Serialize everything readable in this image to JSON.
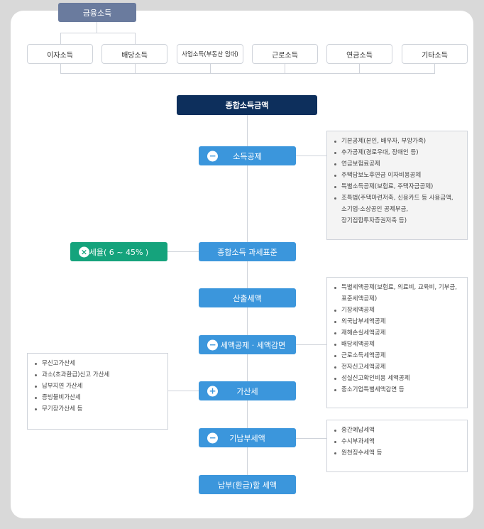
{
  "top": "금융소득",
  "income_types": [
    "이자소득",
    "배당소득",
    "사업소득(부동산 임대)",
    "근로소득",
    "연금소득",
    "기타소득"
  ],
  "flow": {
    "total": "종합소득금액",
    "deduction": "소득공제",
    "tax_base": "종합소득 과세표준",
    "tax_rate": "세율( 6 ~ 45% )",
    "computed": "산출세액",
    "credit": "세액공제 · 세액감면",
    "additional": "가산세",
    "prepaid": "기납부세액",
    "final": "납부(환급)할 세액"
  },
  "symbols": {
    "minus": "−",
    "plus": "+",
    "times": "×"
  },
  "deduction_list": [
    [
      "기본공제(본인, 배우자, 부양가족)"
    ],
    [
      "추가공제(경로우대, 장애인 등)"
    ],
    [
      "연금보험료공제"
    ],
    [
      "주택담보노후연금 이자비용공제"
    ],
    [
      "특별소득공제(보험료, 주택자금공제)"
    ],
    [
      "조특법(주택마련저축, 신용카드 등 사용금액,",
      "소기업·소상공인 공제부금,",
      "장기집합투자증권저축 등)"
    ]
  ],
  "credit_list": [
    [
      "특별세액공제(보험료, 의료비, 교육비, 기부금,",
      "표준세액공제)"
    ],
    [
      "기장세액공제"
    ],
    [
      "외국납부세액공제"
    ],
    [
      "재해손실세액공제"
    ],
    [
      "배당세액공제"
    ],
    [
      "근로소득세액공제"
    ],
    [
      "전자신고세액공제"
    ],
    [
      "성실신고확인비용 세액공제"
    ],
    [
      "중소기업특별세액감면 등"
    ]
  ],
  "additional_list": [
    [
      "무신고가산세"
    ],
    [
      "과소(초과환급)신고 가산세"
    ],
    [
      "납부지연 가산세"
    ],
    [
      "증빙불비가산세"
    ],
    [
      "무기장가산세 등"
    ]
  ],
  "prepaid_list": [
    [
      "중간예납세액"
    ],
    [
      "수시부과세액"
    ],
    [
      "원천징수세액 등"
    ]
  ]
}
